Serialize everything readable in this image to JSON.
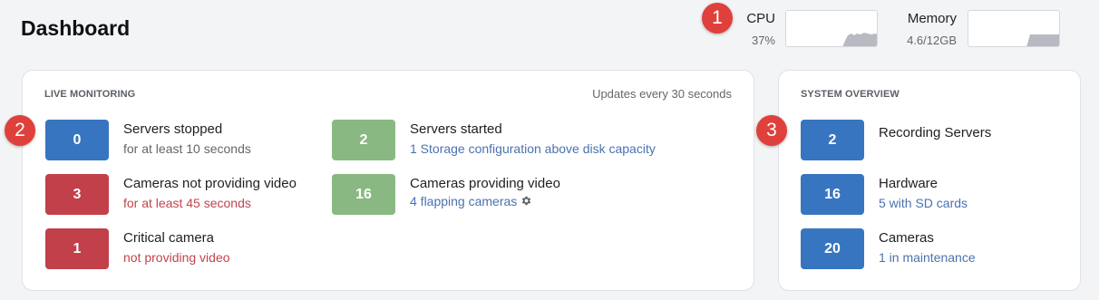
{
  "header": {
    "title": "Dashboard",
    "cpu": {
      "label": "CPU",
      "value": "37%",
      "load": 0.37
    },
    "memory": {
      "label": "Memory",
      "value": "4.6/12GB",
      "usage": 0.38
    }
  },
  "callouts": [
    "1",
    "2",
    "3"
  ],
  "live_monitoring": {
    "title": "LIVE MONITORING",
    "note": "Updates every 30 seconds",
    "items": [
      {
        "count": "0",
        "color": "blue",
        "title": "Servers stopped",
        "subtitle": "for at least 10 seconds"
      },
      {
        "count": "3",
        "color": "red",
        "title": "Cameras not providing video",
        "subtitle": "for at least 45 seconds"
      },
      {
        "count": "1",
        "color": "red",
        "title": "Critical camera",
        "subtitle": "not providing video"
      },
      {
        "count": "2",
        "color": "green",
        "title": "Servers started",
        "subtitle": "1 Storage configuration above disk capacity"
      },
      {
        "count": "16",
        "color": "green",
        "title": "Cameras providing video",
        "subtitle": "4 flapping cameras",
        "subtitle_icon": "gear-icon"
      }
    ]
  },
  "system_overview": {
    "title": "SYSTEM OVERVIEW",
    "items": [
      {
        "count": "2",
        "color": "blue",
        "title": "Recording Servers",
        "subtitle": ""
      },
      {
        "count": "16",
        "color": "blue",
        "title": "Hardware",
        "subtitle": "5 with SD cards"
      },
      {
        "count": "20",
        "color": "blue",
        "title": "Cameras",
        "subtitle": "1 in maintenance"
      }
    ]
  },
  "colors": {
    "blue": "#3775c0",
    "red": "#c1404a",
    "green": "#8ab882",
    "callout": "#e0403b",
    "link": "#4a72b0"
  }
}
